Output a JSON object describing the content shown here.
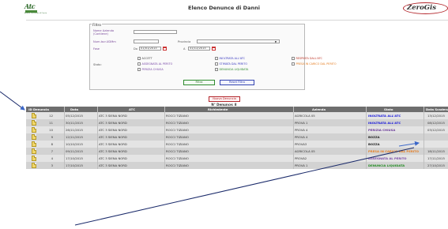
{
  "header": {
    "title": "Elenco Denunce di Danni",
    "logo_left_text": "Atc",
    "logo_left_sub": "Ambito Territoriale di Caccia",
    "logo_right_text": "ZeroGis"
  },
  "filter": {
    "legend": "Filtro",
    "labels": {
      "nome_azienda": "Nome Azienda",
      "nome_azienda_sub": "(Contiene)",
      "num_iscr": "Num.Iscr.UDMm",
      "provincia": "Provincia",
      "fase": "Fase",
      "stato": "Stato:"
    },
    "inputs": {
      "nome_azienda": "",
      "num_iscr": "",
      "da_label": "Da",
      "da_value": "01/01/2015",
      "a_label": "A",
      "a_value": "31/12/2015"
    },
    "stato_options": [
      {
        "label": "ACCETT",
        "color": "#444444"
      },
      {
        "label": "INOLTRATA ALL'ATC",
        "color": "#3a3ac0"
      },
      {
        "label": "RESPINTA DALL'ATC",
        "color": "#c0392b"
      },
      {
        "label": "ASSEGNATA AL PERITO",
        "color": "#7a4aa8"
      },
      {
        "label": "STIMATA DAL PERITO",
        "color": "#3a3ac0"
      },
      {
        "label": "PRESA IN CARICO DAL PERITO",
        "color": "#e67e22"
      },
      {
        "label": "PERIZIA CHIUSA",
        "color": "#7a4aa8"
      },
      {
        "label": "DENUNCIA LIQUIDATA",
        "color": "#2e8b2e"
      }
    ],
    "btn_filtra": "Filtra",
    "btn_reset": "Reset Filtro"
  },
  "actions": {
    "nuova_denuncia": "Nuova Denuncia",
    "count": "N° Denunce: 8"
  },
  "table": {
    "columns": [
      "ID Denuncia",
      "Data",
      "ATC",
      "Richiedente",
      "Azienda",
      "Stato",
      "Data Scadenza"
    ],
    "rows": [
      {
        "id": "12",
        "data": "05/12/2015",
        "atc": "ATC 3 SIENA NORD",
        "richiedente": "ROCCI TIZIANO",
        "azienda": "AGRICOLA 05",
        "stato": "INOLTRATA ALL'ATC",
        "stato_color": "#1a1adc",
        "scadenza": "13/12/2015"
      },
      {
        "id": "11",
        "data": "30/11/2015",
        "atc": "ATC 3 SIENA NORD",
        "richiedente": "ROCCI TIZIANO",
        "azienda": "PROVA 1",
        "stato": "INOLTRATA ALL'ATC",
        "stato_color": "#1a1adc",
        "scadenza": "08/12/2015"
      },
      {
        "id": "10",
        "data": "26/11/2015",
        "atc": "ATC 3 SIENA NORD",
        "richiedente": "ROCCI TIZIANO",
        "azienda": "PROVA 4",
        "stato": "PERIZIA CHIUSA",
        "stato_color": "#6a3a98",
        "scadenza": "03/12/2015"
      },
      {
        "id": "9",
        "data": "12/11/2015",
        "atc": "ATC 3 SIENA NORD",
        "richiedente": "ROCCI TIZIANO",
        "azienda": "PROVA 4",
        "stato": "BOZZA",
        "stato_color": "#222222",
        "scadenza": ""
      },
      {
        "id": "8",
        "data": "10/10/2015",
        "atc": "ATC 3 SIENA NORD",
        "richiedente": "ROCCI TIZIANO",
        "azienda": "PROVA3",
        "stato": "BOZZA",
        "stato_color": "#222222",
        "scadenza": ""
      },
      {
        "id": "7",
        "data": "09/11/2015",
        "atc": "ATC 3 SIENA NORD",
        "richiedente": "ROCCI TIZIANO",
        "azienda": "AGRICOLA 05",
        "stato": "PRESA IN CARICO DAL PERITO",
        "stato_color": "#e67e22",
        "scadenza": "18/11/2015"
      },
      {
        "id": "4",
        "data": "17/10/2015",
        "atc": "ATC 3 SIENA NORD",
        "richiedente": "ROCCI TIZIANO",
        "azienda": "PROVA2",
        "stato": "ASSEGNATA AL PERITO",
        "stato_color": "#7a4aa8",
        "scadenza": "17/11/2015"
      },
      {
        "id": "3",
        "data": "17/10/2015",
        "atc": "ATC 3 SIENA NORD",
        "richiedente": "ROCCI TIZIANO",
        "azienda": "PROVA 1",
        "stato": "DENUNCIA LIQUIDATA",
        "stato_color": "#1e8a1e",
        "scadenza": "27/10/2015"
      }
    ]
  }
}
